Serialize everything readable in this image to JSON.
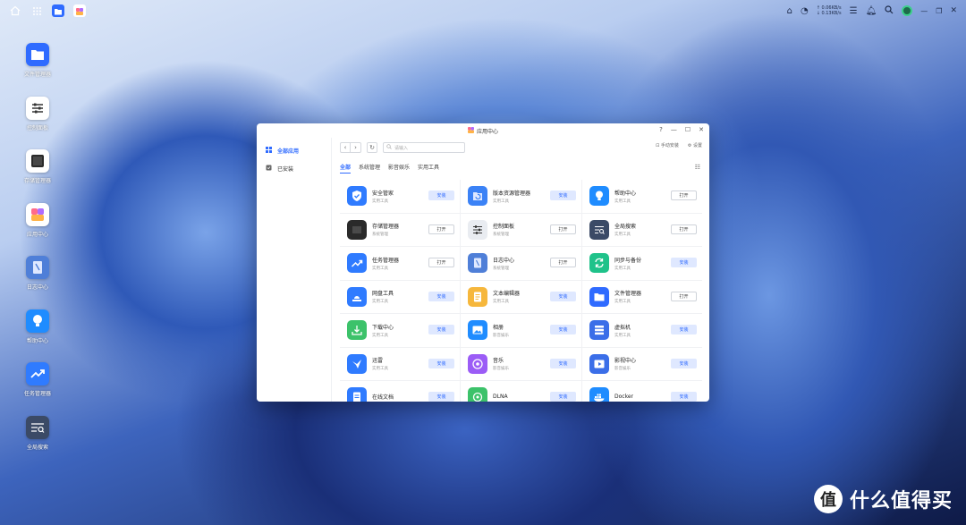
{
  "topbar": {
    "net_up": "↑ 0.06KB/s",
    "net_down": "↓ 0.13KB/s"
  },
  "desktop": {
    "items": [
      {
        "label": "文件管理器",
        "icon": "folder-icon",
        "color": "#2f6bff"
      },
      {
        "label": "控制面板",
        "icon": "sliders-icon",
        "color": "#ffffff"
      },
      {
        "label": "存储管理器",
        "icon": "disk-icon",
        "color": "#ffffff"
      },
      {
        "label": "应用中心",
        "icon": "app-center-icon",
        "color": "#ffffff"
      },
      {
        "label": "日志中心",
        "icon": "log-icon",
        "color": "#4f7fd8"
      },
      {
        "label": "帮助中心",
        "icon": "bulb-icon",
        "color": "#1f8cff"
      },
      {
        "label": "任务管理器",
        "icon": "chart-icon",
        "color": "#2f7bff"
      },
      {
        "label": "全局搜索",
        "icon": "search-doc-icon",
        "color": "#3b4a66"
      }
    ]
  },
  "window": {
    "title": "应用中心",
    "sidebar": {
      "all_apps": "全部应用",
      "installed": "已安装"
    },
    "search_placeholder": "请输入",
    "manual_install": "手动安装",
    "settings": "设置",
    "tabs": [
      "全部",
      "系统管理",
      "影音娱乐",
      "实用工具"
    ],
    "apps": [
      {
        "name": "安全管家",
        "category": "实用工具",
        "action": "安装",
        "action_type": "install",
        "icon": "shield-icon",
        "color": "#2f7bff"
      },
      {
        "name": "版本资源管理器",
        "category": "实用工具",
        "action": "安装",
        "action_type": "install",
        "icon": "version-folder-icon",
        "color": "#3b82f6"
      },
      {
        "name": "帮助中心",
        "category": "实用工具",
        "action": "打开",
        "action_type": "open",
        "icon": "bulb-icon",
        "color": "#1f8cff"
      },
      {
        "name": "存储管理器",
        "category": "系统管理",
        "action": "打开",
        "action_type": "open",
        "icon": "disk-icon",
        "color": "#2a2a2a"
      },
      {
        "name": "控制面板",
        "category": "系统管理",
        "action": "打开",
        "action_type": "open",
        "icon": "sliders-icon",
        "color": "#e9ecf1"
      },
      {
        "name": "全局搜索",
        "category": "实用工具",
        "action": "打开",
        "action_type": "open",
        "icon": "search-doc-icon",
        "color": "#3b4a66"
      },
      {
        "name": "任务管理器",
        "category": "实用工具",
        "action": "打开",
        "action_type": "open",
        "icon": "chart-icon",
        "color": "#2f7bff"
      },
      {
        "name": "日志中心",
        "category": "系统管理",
        "action": "打开",
        "action_type": "open",
        "icon": "log-icon",
        "color": "#4f7fd8"
      },
      {
        "name": "同步与备份",
        "category": "实用工具",
        "action": "安装",
        "action_type": "install",
        "icon": "sync-icon",
        "color": "#1fc28a"
      },
      {
        "name": "网盘工具",
        "category": "实用工具",
        "action": "安装",
        "action_type": "install",
        "icon": "cloud-drive-icon",
        "color": "#2f7bff"
      },
      {
        "name": "文本编辑器",
        "category": "实用工具",
        "action": "安装",
        "action_type": "install",
        "icon": "text-editor-icon",
        "color": "#f6b73c"
      },
      {
        "name": "文件管理器",
        "category": "实用工具",
        "action": "打开",
        "action_type": "open",
        "icon": "folder-icon",
        "color": "#2f6bff"
      },
      {
        "name": "下载中心",
        "category": "实用工具",
        "action": "安装",
        "action_type": "install",
        "icon": "download-icon",
        "color": "#3cc26a"
      },
      {
        "name": "相册",
        "category": "影音娱乐",
        "action": "安装",
        "action_type": "install",
        "icon": "photo-icon",
        "color": "#1f8cff"
      },
      {
        "name": "虚拟机",
        "category": "实用工具",
        "action": "安装",
        "action_type": "install",
        "icon": "vm-icon",
        "color": "#3b6ee8"
      },
      {
        "name": "迅雷",
        "category": "实用工具",
        "action": "安装",
        "action_type": "install",
        "icon": "thunder-icon",
        "color": "#2f7bff"
      },
      {
        "name": "音乐",
        "category": "影音娱乐",
        "action": "安装",
        "action_type": "install",
        "icon": "music-icon",
        "color": "#9b5cf6"
      },
      {
        "name": "影视中心",
        "category": "影音娱乐",
        "action": "安装",
        "action_type": "install",
        "icon": "video-icon",
        "color": "#3b6ee8"
      },
      {
        "name": "在线文档",
        "category": "",
        "action": "安装",
        "action_type": "install",
        "icon": "doc-icon",
        "color": "#2f7bff"
      },
      {
        "name": "DLNA",
        "category": "",
        "action": "安装",
        "action_type": "install",
        "icon": "dlna-icon",
        "color": "#3cc26a"
      },
      {
        "name": "Docker",
        "category": "",
        "action": "安装",
        "action_type": "install",
        "icon": "docker-icon",
        "color": "#1f8cff"
      }
    ]
  },
  "watermark": {
    "badge": "值",
    "text": "什么值得买"
  }
}
